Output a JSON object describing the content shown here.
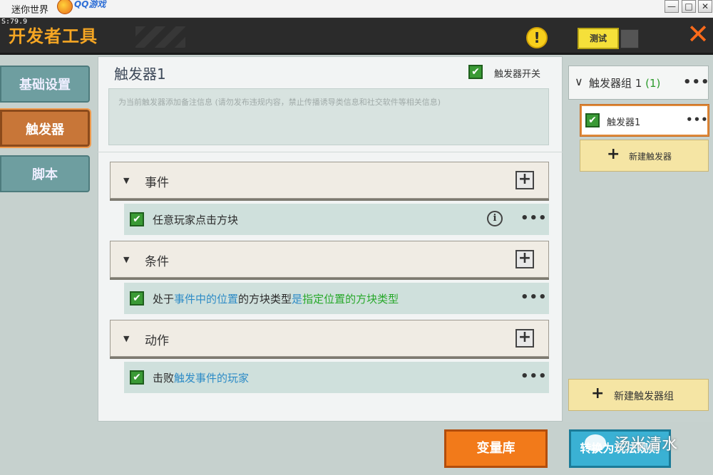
{
  "window": {
    "title": "迷你世界",
    "qq_logo_text": "QQ游戏",
    "min_label": "—",
    "max_label": "□",
    "close_label": "✕"
  },
  "header": {
    "fps": "S:79.9",
    "title": "开发者工具",
    "warning_symbol": "!",
    "test_button": "测试",
    "close_symbol": "✕"
  },
  "nav": {
    "items": [
      {
        "label": "基础设置"
      },
      {
        "label": "触发器"
      },
      {
        "label": "脚本"
      }
    ]
  },
  "trigger": {
    "name": "触发器1",
    "enable_label": "触发器开关",
    "note_placeholder": "为当前触发器添加备注信息 (请勿发布违规内容，禁止传播诱导类信息和社交软件等相关信息)",
    "sections": [
      {
        "title": "事件",
        "rows": [
          {
            "text": "任意玩家点击方块"
          }
        ]
      },
      {
        "title": "条件",
        "rows": [
          {
            "p1": "处于",
            "p2": "事件中的位置",
            "p3": "的方块类型",
            "p4": "是",
            "p5": "指定位置的方块类型"
          }
        ]
      },
      {
        "title": "动作",
        "rows": [
          {
            "p1": "击败",
            "p2": "触发事件的玩家"
          }
        ]
      }
    ],
    "more_symbol": "•••",
    "info_symbol": "i",
    "plus_symbol": "+",
    "caret_symbol": "▼",
    "check_symbol": "✔"
  },
  "sidebar_right": {
    "group_label": "触发器组 1",
    "group_count": "(1)",
    "group_more": "•••",
    "trigger_item": "触发器1",
    "new_trigger": "新建触发器",
    "new_group": "新建触发器组",
    "chevron": "∨"
  },
  "footer": {
    "variable_library": "变量库",
    "convert_label": "转换为玩法规则",
    "watermark": "汤米清水"
  }
}
